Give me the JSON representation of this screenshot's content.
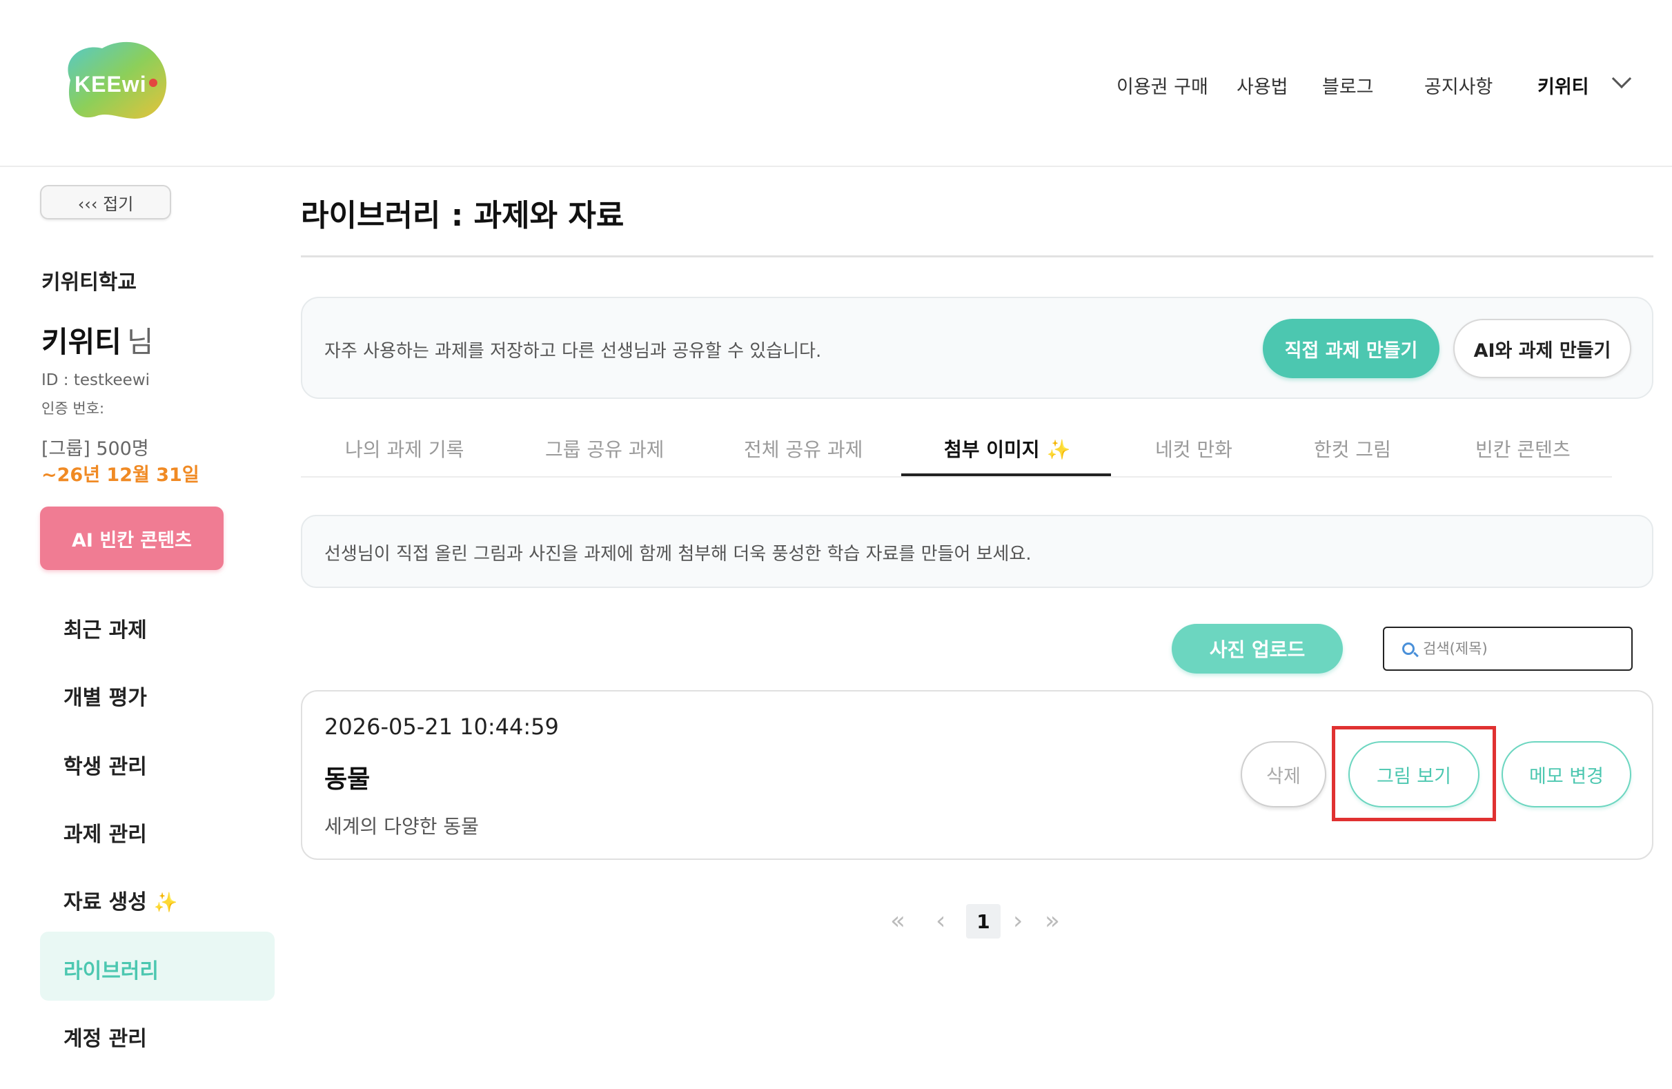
{
  "header": {
    "logo_text": "KEEwi",
    "nav": [
      "이용권 구매",
      "사용법",
      "블로그",
      "공지사항"
    ],
    "user_menu": "키위티"
  },
  "sidebar": {
    "fold_label": "‹‹‹ 접기",
    "school": "키위티학교",
    "user_name": "키위티",
    "user_suffix": "님",
    "user_id": "ID : testkeewi",
    "cert_label": "인증 번호:",
    "plan": "[그룹] 500명",
    "expiry": "~26년 12월 31일",
    "ai_button": "AI 빈칸 콘텐츠",
    "items": [
      {
        "label": "최근 과제"
      },
      {
        "label": "개별 평가"
      },
      {
        "label": "학생 관리"
      },
      {
        "label": "과제 관리"
      },
      {
        "label": "자료 생성"
      },
      {
        "label": "라이브러리"
      },
      {
        "label": "계정 관리"
      }
    ],
    "active_item": "라이브러리"
  },
  "main": {
    "title": "라이브러리 : 과제와 자료",
    "info_text": "자주 사용하는 과제를 저장하고 다른 선생님과 공유할 수 있습니다.",
    "btn_direct": "직접 과제 만들기",
    "btn_ai": "AI와 과제 만들기",
    "tabs": [
      {
        "label": "나의 과제 기록"
      },
      {
        "label": "그룹 공유 과제"
      },
      {
        "label": "전체 공유 과제"
      },
      {
        "label": "첨부 이미지"
      },
      {
        "label": "네컷 만화"
      },
      {
        "label": "한컷 그림"
      },
      {
        "label": "빈칸 콘텐츠"
      }
    ],
    "active_tab": "첨부 이미지",
    "description": "선생님이 직접 올린 그림과 사진을 과제에 함께 첨부해 더욱 풍성한 학습 자료를 만들어 보세요.",
    "upload_button": "사진 업로드",
    "search_placeholder": "검색(제목)",
    "card": {
      "date": "2026-05-21 10:44:59",
      "title": "동물",
      "description": "세계의 다양한 동물",
      "btn_delete": "삭제",
      "btn_view": "그림 보기",
      "btn_memo": "메모 변경"
    },
    "pagination": {
      "current_page": "1",
      "first": "«",
      "prev": "‹",
      "next": "›",
      "last": "»"
    }
  },
  "colors": {
    "accent": "#4cc7b0",
    "pink": "#f07c93",
    "orange": "#f08a24",
    "highlight": "#e03131"
  },
  "icons": {
    "sparkle": "✨"
  }
}
